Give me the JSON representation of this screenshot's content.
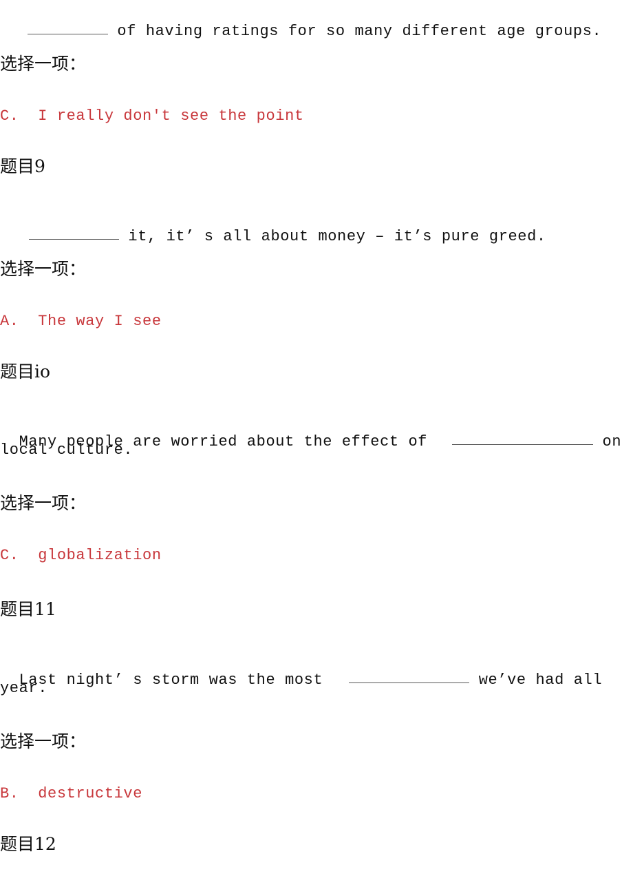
{
  "document": {
    "questions": [
      {
        "id": "q8",
        "title": "",
        "stem_before": "",
        "stem_after": " of having ratings for so many different age groups.",
        "prompt": "选择一项：",
        "answer": "C.  I really don't see the point"
      },
      {
        "id": "q9",
        "title": "题目9",
        "stem_before": "",
        "stem_after": " it, it’ s all about money – it’s pure greed.",
        "prompt": "选择一项：",
        "answer": "A.  The way I see"
      },
      {
        "id": "q10",
        "title": "题目io",
        "stem_before": "Many people are worried about the effect of  ",
        "stem_after": " on",
        "stem_line2": "local culture.",
        "prompt": "选择一项：",
        "answer": "C.  globalization"
      },
      {
        "id": "q11",
        "title": "题目11",
        "stem_before": "Last night’ s storm was the most  ",
        "stem_after": " we’ve had all",
        "stem_line2": "year.",
        "prompt": "选择一项：",
        "answer": "B.  destructive"
      },
      {
        "id": "q12",
        "title": "题目12"
      }
    ],
    "answer_color": "#c8373b"
  }
}
